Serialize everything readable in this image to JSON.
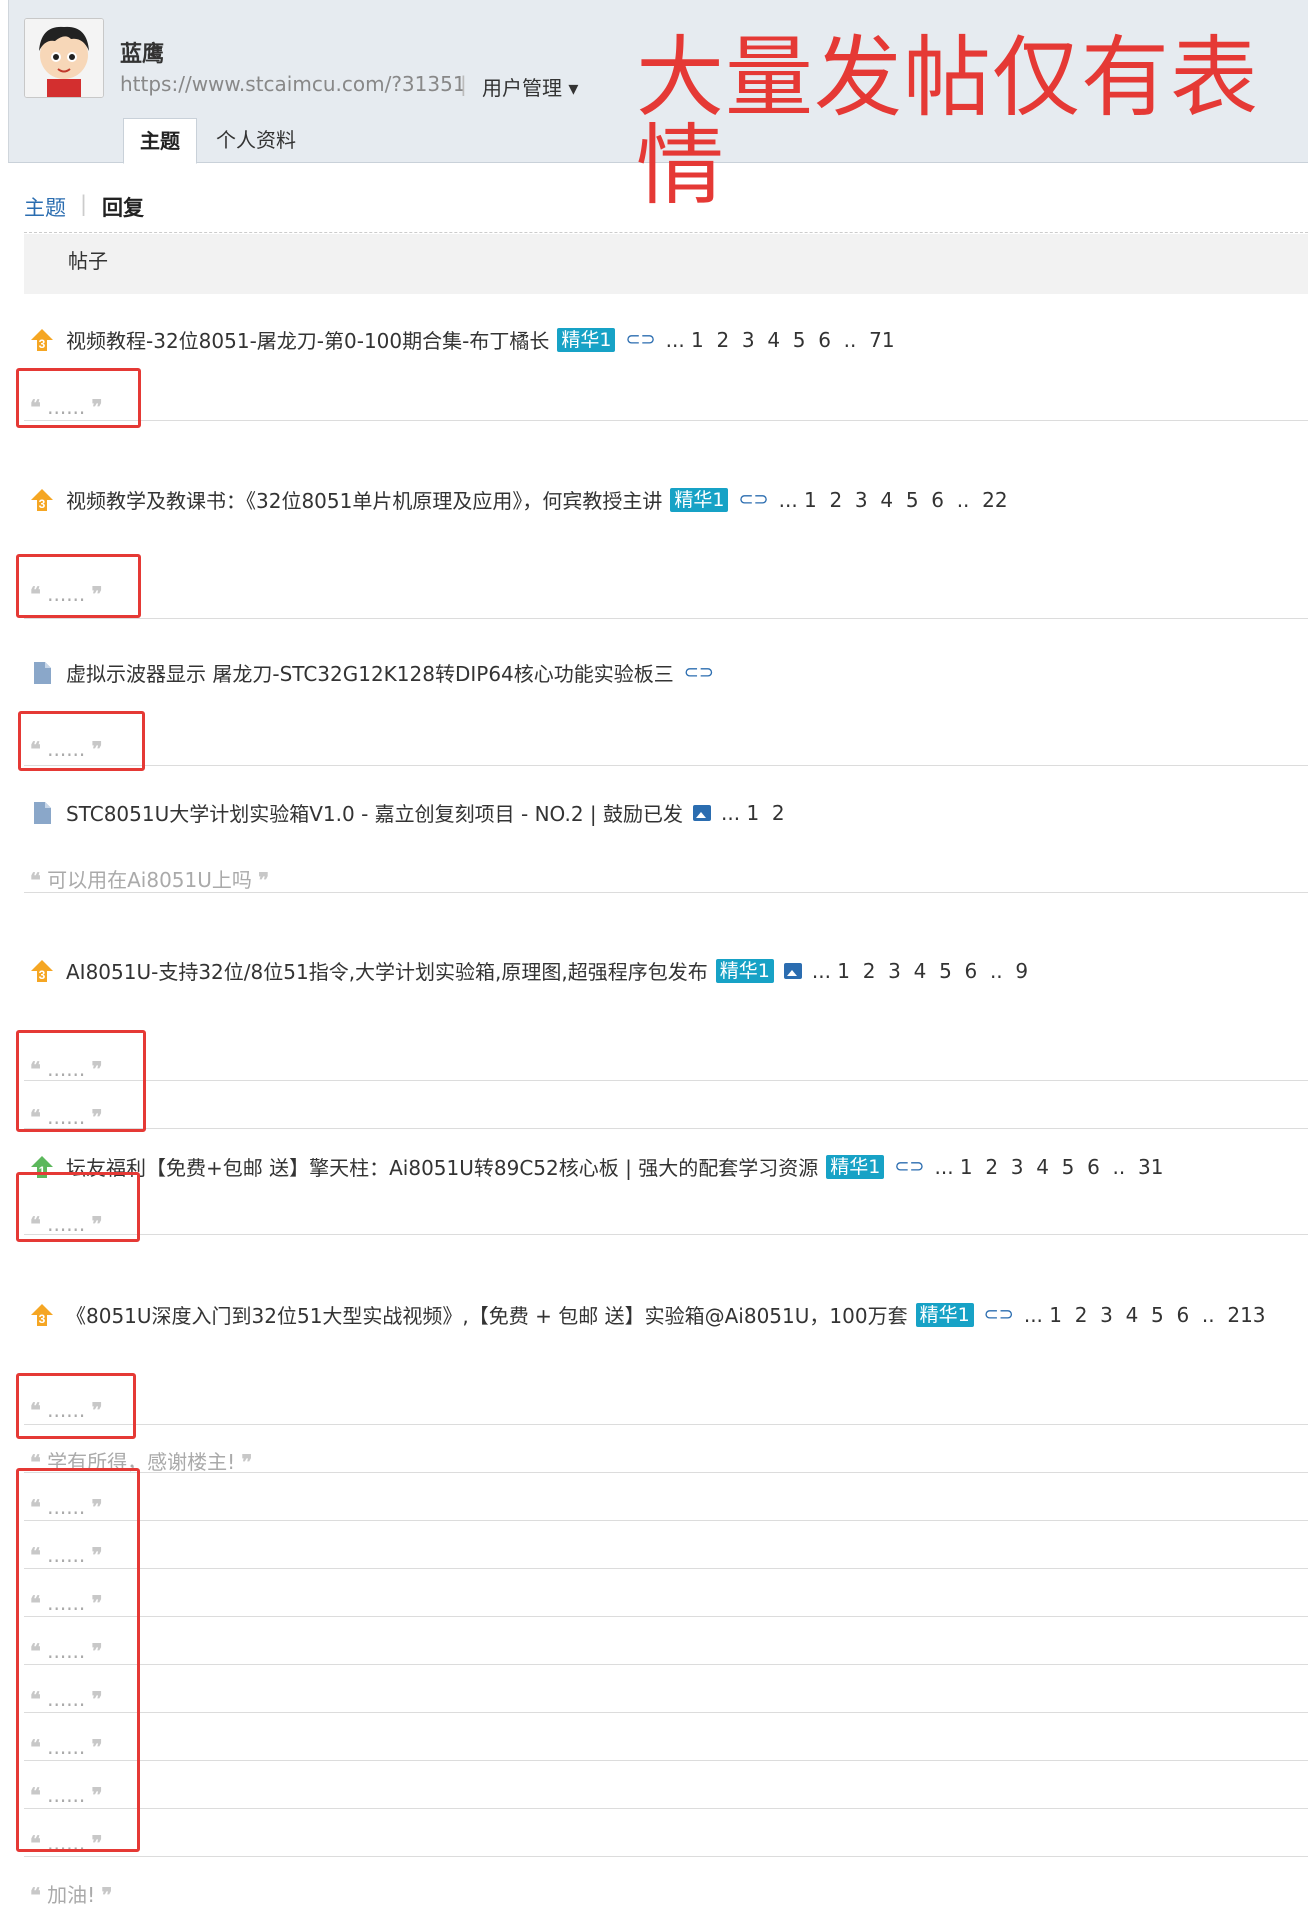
{
  "header": {
    "username": "蓝鹰",
    "url": "https://www.stcaimcu.com/?31351",
    "separator": "|",
    "user_manage": "用户管理 ▾",
    "banner": "大量发帖仅有表情",
    "tabs": [
      "主题",
      "个人资料"
    ]
  },
  "subnav": {
    "topic": "主题",
    "separator": "|",
    "reply": "回复"
  },
  "table_header": "帖子",
  "threads": [
    {
      "icon": "hot-3-icon",
      "title": "视频教程-32位8051-屠龙刀-第0-100期合集-布丁橘长",
      "badge": "精华1",
      "attach": "attachment-icon",
      "pages": "... 1  2  3  4  5  6  ..  71"
    },
    {
      "icon": "hot-3-icon",
      "title": "视频教学及教课书：《32位8051单片机原理及应用》，何宾教授主讲",
      "badge": "精华1",
      "attach": "attachment-icon",
      "pages": "... 1  2  3  4  5  6  ..  22"
    },
    {
      "icon": "document-icon",
      "title": "虚拟示波器显示 屠龙刀-STC32G12K128转DIP64核心功能实验板三",
      "badge": "",
      "attach": "attachment-icon",
      "pages": ""
    },
    {
      "icon": "document-icon",
      "title": "STC8051U大学计划实验箱V1.0 - 嘉立创复刻项目 - NO.2 | 鼓励已发",
      "badge": "",
      "attach": "image-icon",
      "pages": "... 1  2"
    },
    {
      "icon": "hot-3-icon",
      "title": "AI8051U-支持32位/8位51指令,大学计划实验箱,原理图,超强程序包发布",
      "badge": "精华1",
      "attach": "image-icon",
      "pages": "... 1  2  3  4  5  6  ..  9"
    },
    {
      "icon": "hot-1-icon",
      "title": "坛友福利【免费+包邮 送】擎天柱：Ai8051U转89C52核心板 | 强大的配套学习资源",
      "badge": "精华1",
      "attach": "attachment-icon",
      "pages": "... 1  2  3  4  5  6  ..  31"
    },
    {
      "icon": "hot-3-icon",
      "title": "《8051U深度入门到32位51大型实战视频》,【免费 + 包邮 送】实验箱@Ai8051U，100万套",
      "badge": "精华1",
      "attach": "attachment-icon",
      "pages": "... 1  2  3  4  5  6  ..  213"
    }
  ],
  "quotes": {
    "open": "66",
    "close": "99",
    "ellipsis": "......",
    "reply_1": "可以用在Ai8051U上吗",
    "reply_2": "学有所得，感谢楼主!",
    "reply_3": "加油!"
  },
  "colors": {
    "banner": "#e53935",
    "badge": "#17a2c6",
    "link": "#2b6db0",
    "hot": "#f5a623",
    "hot_green": "#5cb85c"
  }
}
